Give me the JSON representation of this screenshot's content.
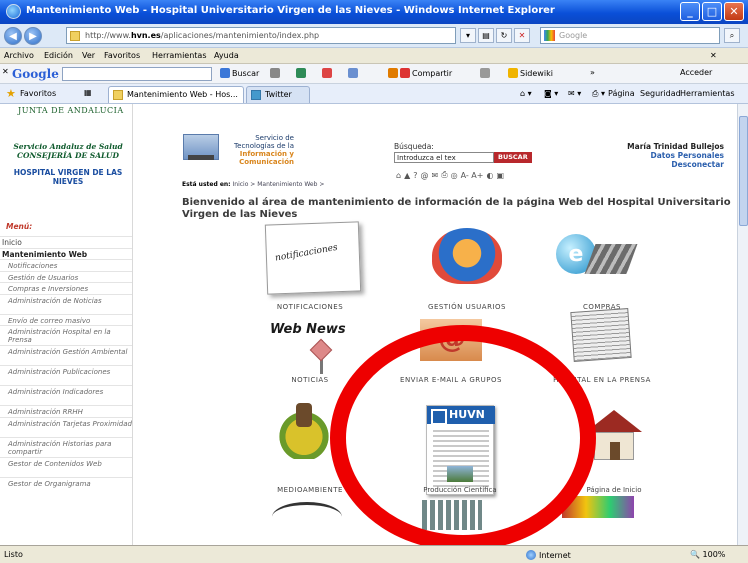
{
  "window": {
    "title": "Mantenimiento Web - Hospital Universitario Virgen de las Nieves - Windows Internet Explorer",
    "minimize": "_",
    "maximize": "□",
    "close": "✕"
  },
  "address": {
    "url_prefix": "http://www.",
    "url_domain": "hvn.es",
    "url_path": "/aplicaciones/mantenimiento/index.php",
    "search_placeholder": "Google"
  },
  "menu": [
    "Archivo",
    "Edición",
    "Ver",
    "Favoritos",
    "Herramientas",
    "Ayuda"
  ],
  "google_toolbar": {
    "logo": "Google",
    "buscar": "Buscar",
    "compartir": "Compartir",
    "sidewiki": "Sidewiki",
    "acceder": "Acceder"
  },
  "favorites": {
    "label": "Favoritos",
    "tabs": [
      "Mantenimiento Web - Hos...",
      "Twitter"
    ],
    "tools": [
      "Página",
      "Seguridad",
      "Herramientas"
    ]
  },
  "sidebar": {
    "junta": "JUNTA DE ANDALUCIA",
    "sas": "Servicio Andaluz de Salud CONSEJERÍA DE SALUD",
    "hospital": "HOSPITAL VIRGEN DE LAS NIEVES",
    "menu_title": "Menú:",
    "items": [
      {
        "label": "Inicio",
        "kind": "top"
      },
      {
        "label": "Mantenimiento Web",
        "kind": "head"
      },
      {
        "label": "Notificaciones",
        "kind": "sub"
      },
      {
        "label": "Gestión de Usuarios",
        "kind": "sub"
      },
      {
        "label": "Compras e Inversiones",
        "kind": "sub"
      },
      {
        "label": "Administración de Noticias",
        "kind": "sub"
      },
      {
        "label": "Envío de correo masivo",
        "kind": "sub"
      },
      {
        "label": "Administración Hospital en la Prensa",
        "kind": "sub"
      },
      {
        "label": "Administración Gestión Ambiental",
        "kind": "sub"
      },
      {
        "label": "Administración Publicaciones",
        "kind": "sub"
      },
      {
        "label": "Administración Indicadores",
        "kind": "sub"
      },
      {
        "label": "Administración RRHH",
        "kind": "sub"
      },
      {
        "label": "Administración Tarjetas Proximidad",
        "kind": "sub"
      },
      {
        "label": "Administración Historias para compartir",
        "kind": "sub"
      },
      {
        "label": "Gestor de Contenidos Web",
        "kind": "sub"
      },
      {
        "label": "Gestor de Organigrama",
        "kind": "sub"
      }
    ]
  },
  "header": {
    "stc_line1": "Servicio de Tecnologías de la",
    "stc_line2": "Información y Comunicación",
    "breadcrumb_lead": "Está usted en:",
    "breadcrumb": "Inicio > Mantenimiento Web >",
    "search_label": "Búsqueda:",
    "search_value": "Introduzca el tex",
    "search_button": "BUSCAR",
    "access_icons": "A- A+",
    "user_name": "María Trinidad Bullejos",
    "user_link1": "Datos Personales",
    "user_link2": "Desconectar"
  },
  "welcome": "Bienvenido al área de mantenimiento de información de la página Web del Hospital Universitario Virgen de las Nieves",
  "tiles": {
    "notificaciones": "NOTIFICACIONES",
    "notificaciones_art": "notificaciones",
    "gestion_usuarios": "GESTIÓN USUARIOS",
    "compras": "COMPRAS",
    "noticias": "NOTICIAS",
    "web_news": "Web News",
    "enviar_email": "ENVIAR E-MAIL A GRUPOS",
    "hospital_prensa": "HOSPITAL EN LA PRENSA",
    "medioambiente": "MEDIOAMBIENTE",
    "produccion": "Producción Científica",
    "pagina_inicio": "Página de Inicio",
    "huvn": "HUVN"
  },
  "status": {
    "left": "Listo",
    "zone": "Internet",
    "zoom": "100%"
  },
  "colors": {
    "titlebar": "#0a4fd8",
    "annotation_circle": "#ee0000",
    "search_button": "#b8282c"
  }
}
